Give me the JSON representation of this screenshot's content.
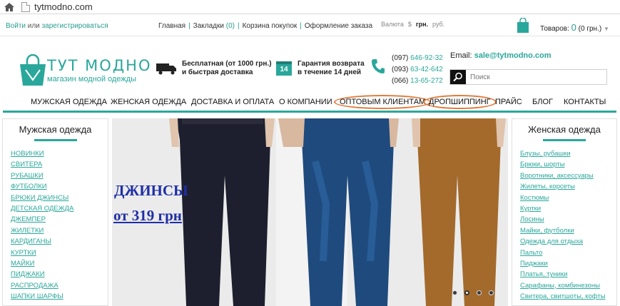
{
  "browser": {
    "url": "tytmodno.com"
  },
  "topbar": {
    "login": "Войти",
    "or": " или ",
    "register": "зарегистрироваться",
    "links": [
      {
        "label": "Главная"
      },
      {
        "label": "Закладки",
        "count": "(0)"
      },
      {
        "label": "Корзина покупок"
      },
      {
        "label": "Оформление заказа"
      }
    ],
    "currency_label": "Валюта",
    "currencies": [
      "$",
      "грн.",
      "руб."
    ],
    "currency_active": "грн.",
    "cart_label": "Товаров:",
    "cart_count": "0",
    "cart_sum": "(0 грн.)"
  },
  "header": {
    "brand_name": "ТУТ МОДНО",
    "brand_tagline": "магазин модной одежды",
    "feature1_line1": "Бесплатная (от 1000 грн.)",
    "feature1_line2": "и быстрая доставка",
    "feature2_badge": "14",
    "feature2_line1": "Гарантия возврата",
    "feature2_line2": "в течение 14 дней",
    "phones": [
      {
        "code": "(097)",
        "number": "646-92-32"
      },
      {
        "code": "(093)",
        "number": "63-42-642"
      },
      {
        "code": "(066)",
        "number": "13-65-272"
      }
    ],
    "email_label": "Email:",
    "email": "sale@tytmodno.com",
    "search_placeholder": "Поиск"
  },
  "nav": [
    "МУЖСКАЯ ОДЕЖДА",
    "ЖЕНСКАЯ ОДЕЖДА",
    "ДОСТАВКА И ОПЛАТА",
    "О КОМПАНИИ",
    "ОПТОВЫМ КЛИЕНТАМ",
    "ДРОПШИППИНГ",
    "ПРАЙС",
    "БЛОГ",
    "КОНТАКТЫ"
  ],
  "left_sidebar": {
    "title": "Мужская одежда",
    "items": [
      "НОВИНКИ",
      "СВИТЕРА",
      "РУБАШКИ",
      "ФУТБОЛКИ",
      "БРЮКИ ДЖИНСЫ",
      "ДЕТСКАЯ ОДЕЖДА",
      "ДЖЕМПЕР",
      "ЖИЛЕТКИ",
      "КАРДИГАНЫ",
      "КУРТКИ",
      "МАЙКИ",
      "ПИДЖАКИ",
      "РАСПРОДАЖА",
      "ШАПКИ ШАРФЫ"
    ]
  },
  "right_sidebar": {
    "title": "Женская одежда",
    "items": [
      "Блузы, рубашки",
      "Брюки, шорты",
      "Воротники, аксессуары",
      "Жилеты, корсеты",
      "Костюмы",
      "Куртки",
      "Лосины",
      "Майки, футболки",
      "Одежда для отдыха",
      "Пальто",
      "Пиджаки",
      "Платья, туники",
      "Сарафаны, комбинезоны",
      "Свитера, свитшоты, кофты"
    ]
  },
  "banner": {
    "promo_line1": "ДЖИНСЫ",
    "promo_line2": "от 319 грн",
    "slide_count": 4,
    "active_slide": 2
  },
  "colors": {
    "accent": "#2aa79b",
    "highlight_circle": "#e07a3a",
    "promo_text": "#1f2fa6"
  }
}
